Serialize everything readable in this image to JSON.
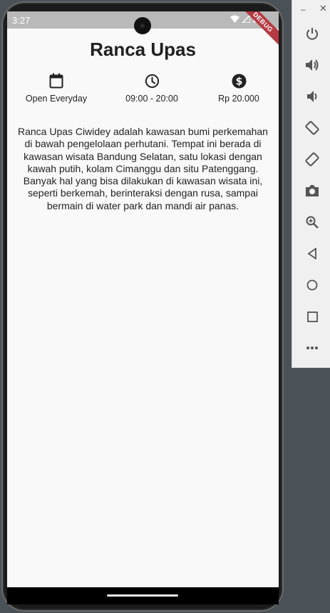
{
  "status": {
    "time": "3:27",
    "debug_label": "DEBUG"
  },
  "page": {
    "title": "Ranca Upas",
    "info": [
      {
        "icon": "calendar-icon",
        "label": "Open Everyday"
      },
      {
        "icon": "clock-icon",
        "label": "09:00 - 20:00"
      },
      {
        "icon": "dollar-icon",
        "label": "Rp 20.000"
      }
    ],
    "description": "Ranca Upas Ciwidey adalah kawasan bumi perkemahan di bawah pengelolaan perhutani. Tempat ini berada di kawasan wisata Bandung Selatan, satu lokasi dengan kawah putih, kolam Cimanggu dan situ Patenggang. Banyak hal yang bisa dilakukan di kawasan wisata ini, seperti berkemah, berinteraksi dengan rusa, sampai bermain di water park dan mandi air panas."
  },
  "emulator_toolbar": {
    "buttons": [
      "power-icon",
      "volume-up-icon",
      "volume-down-icon",
      "rotate-left-icon",
      "rotate-right-icon",
      "camera-icon",
      "zoom-icon",
      "back-icon",
      "home-icon",
      "overview-icon",
      "more-icon"
    ]
  },
  "colors": {
    "accent_debug": "#b53a42",
    "background": "#f9f9f9",
    "statusbar": "#b9b9b9"
  }
}
